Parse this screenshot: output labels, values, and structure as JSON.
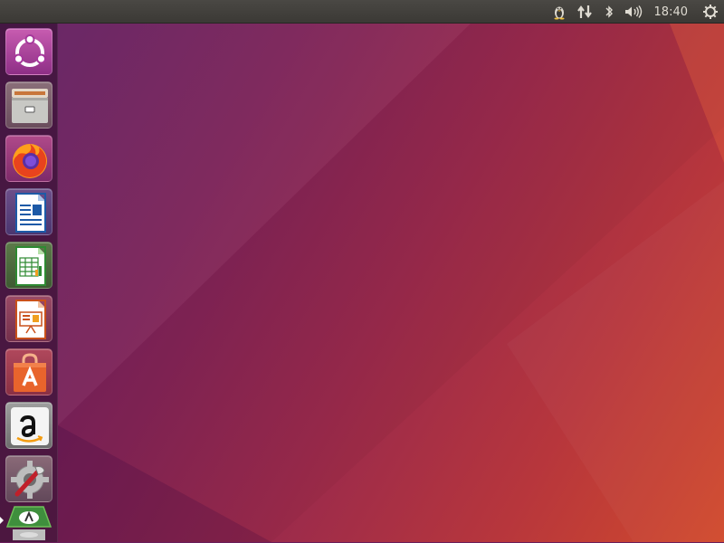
{
  "panel": {
    "clock_text": "18:40",
    "indicators": [
      "tux-icon",
      "network-transfer-icon",
      "bluetooth-icon",
      "volume-icon",
      "power-gear-icon"
    ]
  },
  "launcher": {
    "items": [
      {
        "name": "ubuntu-dash",
        "icon": "ubuntu-logo-icon",
        "color": "#b23d9b"
      },
      {
        "name": "files",
        "icon": "file-cabinet-icon",
        "color": "#c8c8c4"
      },
      {
        "name": "firefox",
        "icon": "firefox-icon",
        "color": "#e85c1d"
      },
      {
        "name": "libreoffice-writer",
        "icon": "writer-document-icon",
        "color": "#1d5aa7"
      },
      {
        "name": "libreoffice-calc",
        "icon": "calc-spreadsheet-icon",
        "color": "#2e8a32"
      },
      {
        "name": "libreoffice-impress",
        "icon": "impress-presentation-icon",
        "color": "#c9511b"
      },
      {
        "name": "ubuntu-software",
        "icon": "shopping-bag-a-icon",
        "color": "#e8642c"
      },
      {
        "name": "amazon",
        "icon": "amazon-a-icon",
        "color": "#f2f2f2"
      },
      {
        "name": "system-settings",
        "icon": "settings-gear-wrench-icon",
        "color": "#9a9a9a"
      },
      {
        "name": "software-updater",
        "icon": "updater-tray-icon",
        "color": "#3f8f3d"
      }
    ]
  },
  "desktop": {
    "accent_colors": [
      "#5e1f63",
      "#9a2a4c",
      "#d14a2c"
    ]
  }
}
